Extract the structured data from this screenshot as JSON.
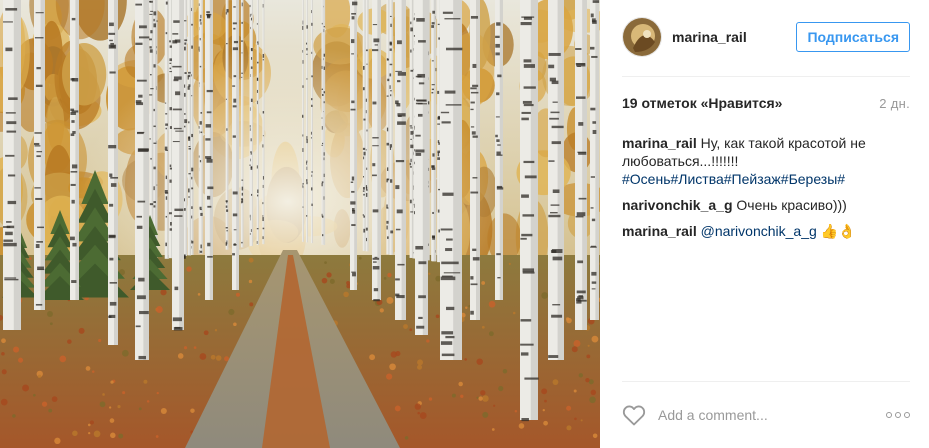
{
  "post": {
    "username": "marina_rail",
    "follow_label": "Подписаться",
    "likes_text": "19 отметок «Нравится»",
    "time_ago": "2 дн.",
    "comments": [
      {
        "user": "marina_rail",
        "text": "Ну, как такой красотой не любоваться...!!!!!!!",
        "tags": "#Осень#Листва#Пейзаж#Березы#"
      },
      {
        "user": "narivonchik_a_g",
        "text": "Очень красиво)))"
      },
      {
        "user": "marina_rail",
        "mention": "@narivonchik_a_g",
        "emoji": "👍👌"
      }
    ],
    "comment_placeholder": "Add a comment...",
    "icons": {
      "like": "heart-icon",
      "more": "more-options-icon"
    },
    "colors": {
      "accent": "#3897f0",
      "hashtag": "#003569",
      "muted": "#999999"
    }
  }
}
